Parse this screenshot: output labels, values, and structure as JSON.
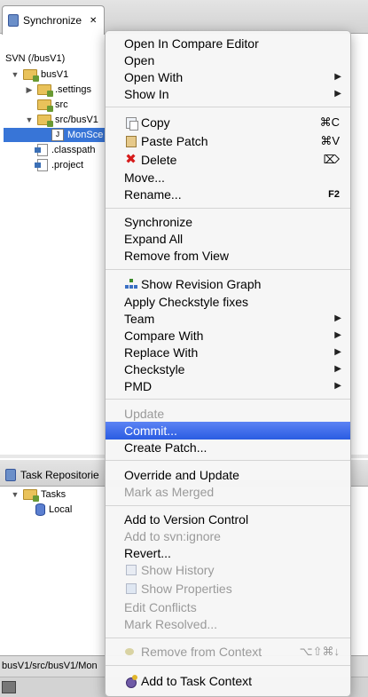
{
  "synchronize_view": {
    "tab_title": "Synchronize",
    "root_label": "SVN (/busV1)",
    "tree": [
      {
        "label": "busV1"
      },
      {
        "label": ".settings"
      },
      {
        "label": "src"
      },
      {
        "label": "src/busV1"
      },
      {
        "label": "MonSce"
      },
      {
        "label": ".classpath"
      },
      {
        "label": ".project"
      }
    ]
  },
  "task_view": {
    "tab_title": "Task Repositorie",
    "tree": [
      {
        "label": "Tasks"
      },
      {
        "label": "Local"
      }
    ]
  },
  "status_bar": {
    "path": "busV1/src/busV1/Mon"
  },
  "menu": {
    "items": [
      {
        "label": "Open In Compare Editor"
      },
      {
        "label": "Open"
      },
      {
        "label": "Open With",
        "submenu": "▶"
      },
      {
        "label": "Show In",
        "submenu": "▶"
      },
      {
        "label": "Copy",
        "shortcut": "⌘C",
        "icon": "copy-icon"
      },
      {
        "label": "Paste Patch",
        "shortcut": "⌘V",
        "icon": "paste-icon"
      },
      {
        "label": "Delete",
        "shortcut": "⌦",
        "icon": "delete-icon"
      },
      {
        "label": "Move..."
      },
      {
        "label": "Rename...",
        "shortcut": "F2"
      },
      {
        "label": "Synchronize"
      },
      {
        "label": "Expand All"
      },
      {
        "label": "Remove from View"
      },
      {
        "label": "Show Revision Graph",
        "icon": "revision-graph-icon"
      },
      {
        "label": "Apply Checkstyle fixes"
      },
      {
        "label": "Team",
        "submenu": "▶"
      },
      {
        "label": "Compare With",
        "submenu": "▶"
      },
      {
        "label": "Replace With",
        "submenu": "▶"
      },
      {
        "label": "Checkstyle",
        "submenu": "▶"
      },
      {
        "label": "PMD",
        "submenu": "▶"
      },
      {
        "label": "Update"
      },
      {
        "label": "Commit..."
      },
      {
        "label": "Create Patch..."
      },
      {
        "label": "Override and Update"
      },
      {
        "label": "Mark as Merged"
      },
      {
        "label": "Add to Version Control"
      },
      {
        "label": "Add to svn:ignore"
      },
      {
        "label": "Revert..."
      },
      {
        "label": "Show History",
        "icon": "history-icon"
      },
      {
        "label": "Show Properties",
        "icon": "properties-icon"
      },
      {
        "label": "Edit Conflicts"
      },
      {
        "label": "Mark Resolved..."
      },
      {
        "label": "Remove from Context",
        "shortcut": "⌥⇧⌘↓",
        "icon": "remove-context-icon"
      },
      {
        "label": "Add to Task Context",
        "icon": "add-context-icon"
      }
    ]
  }
}
